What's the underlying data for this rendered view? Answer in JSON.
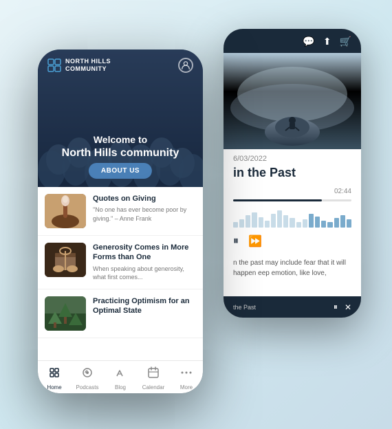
{
  "brand": {
    "name_line1": "NORTH HILLS",
    "name_line2": "COMMUNITY",
    "logo_icon": "✦"
  },
  "hero": {
    "welcome_text": "Welcome to",
    "title_text": "North Hills community",
    "about_button": "ABOUT US"
  },
  "list_items": [
    {
      "title": "Quotes on Giving",
      "description": "\"No one has ever become poor by giving.\" – Anne Frank",
      "thumb_class": "thumb-giving"
    },
    {
      "title": "Generosity Comes in More Forms than One",
      "description": "When speaking about generosity, what first comes...",
      "thumb_class": "thumb-generosity"
    },
    {
      "title": "Practicing Optimism for an Optimal State",
      "description": "",
      "thumb_class": "thumb-optimism"
    }
  ],
  "bottom_nav": [
    {
      "icon": "✦",
      "label": "Home",
      "active": true
    },
    {
      "icon": "◎",
      "label": "Podcasts",
      "active": false
    },
    {
      "icon": "✎",
      "label": "Blog",
      "active": false
    },
    {
      "icon": "▦",
      "label": "Calendar",
      "active": false
    },
    {
      "icon": "⋯",
      "label": "More",
      "active": false
    }
  ],
  "back_phone": {
    "date": "6/03/2022",
    "title": "in the Past",
    "audio_time": "02:44",
    "text_preview": "n the past may include\nfear that it will happen\neep emotion, like love,",
    "bottom_label": "the Past",
    "status_icons": [
      "💬",
      "⬆",
      "🛒"
    ]
  }
}
